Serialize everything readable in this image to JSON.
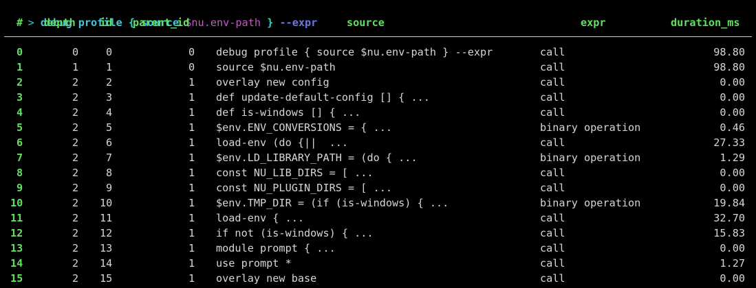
{
  "prompt": {
    "indicator": ">",
    "command": "debug profile",
    "open_brace": "{",
    "inner_command": "source",
    "variable": "$nu.env-path",
    "close_brace": "}",
    "flag": "--expr"
  },
  "table": {
    "columns": [
      "#",
      "depth",
      "id",
      "parent_id",
      "source",
      "expr",
      "duration_ms"
    ],
    "rows": [
      {
        "idx": "0",
        "depth": "0",
        "id": "0",
        "parent_id": "0",
        "source": "debug profile { source $nu.env-path } --expr",
        "expr": "call",
        "duration_ms": "98.80"
      },
      {
        "idx": "1",
        "depth": "1",
        "id": "1",
        "parent_id": "0",
        "source": "source $nu.env-path",
        "expr": "call",
        "duration_ms": "98.80"
      },
      {
        "idx": "2",
        "depth": "2",
        "id": "2",
        "parent_id": "1",
        "source": "overlay new config",
        "expr": "call",
        "duration_ms": "0.00"
      },
      {
        "idx": "3",
        "depth": "2",
        "id": "3",
        "parent_id": "1",
        "source": "def update-default-config [] { ...",
        "expr": "call",
        "duration_ms": "0.00"
      },
      {
        "idx": "4",
        "depth": "2",
        "id": "4",
        "parent_id": "1",
        "source": "def is-windows [] { ...",
        "expr": "call",
        "duration_ms": "0.00"
      },
      {
        "idx": "5",
        "depth": "2",
        "id": "5",
        "parent_id": "1",
        "source": "$env.ENV_CONVERSIONS = { ...",
        "expr": "binary operation",
        "duration_ms": "0.46"
      },
      {
        "idx": "6",
        "depth": "2",
        "id": "6",
        "parent_id": "1",
        "source": "load-env (do {||  ...",
        "expr": "call",
        "duration_ms": "27.33"
      },
      {
        "idx": "7",
        "depth": "2",
        "id": "7",
        "parent_id": "1",
        "source": "$env.LD_LIBRARY_PATH = (do { ...",
        "expr": "binary operation",
        "duration_ms": "1.29"
      },
      {
        "idx": "8",
        "depth": "2",
        "id": "8",
        "parent_id": "1",
        "source": "const NU_LIB_DIRS = [ ...",
        "expr": "call",
        "duration_ms": "0.00"
      },
      {
        "idx": "9",
        "depth": "2",
        "id": "9",
        "parent_id": "1",
        "source": "const NU_PLUGIN_DIRS = [ ...",
        "expr": "call",
        "duration_ms": "0.00"
      },
      {
        "idx": "10",
        "depth": "2",
        "id": "10",
        "parent_id": "1",
        "source": "$env.TMP_DIR = (if (is-windows) { ...",
        "expr": "binary operation",
        "duration_ms": "19.84"
      },
      {
        "idx": "11",
        "depth": "2",
        "id": "11",
        "parent_id": "1",
        "source": "load-env { ...",
        "expr": "call",
        "duration_ms": "32.70"
      },
      {
        "idx": "12",
        "depth": "2",
        "id": "12",
        "parent_id": "1",
        "source": "if not (is-windows) { ...",
        "expr": "call",
        "duration_ms": "15.83"
      },
      {
        "idx": "13",
        "depth": "2",
        "id": "13",
        "parent_id": "1",
        "source": "module prompt { ...",
        "expr": "call",
        "duration_ms": "0.00"
      },
      {
        "idx": "14",
        "depth": "2",
        "id": "14",
        "parent_id": "1",
        "source": "use prompt *",
        "expr": "call",
        "duration_ms": "1.27"
      },
      {
        "idx": "15",
        "depth": "2",
        "id": "15",
        "parent_id": "1",
        "source": "overlay new base",
        "expr": "call",
        "duration_ms": "0.00"
      }
    ]
  },
  "colors": {
    "background": "#000000",
    "header_green": "#5fe05f",
    "prompt_cyan": "#2fd3c8",
    "command_blue": "#43c6e0",
    "variable_magenta": "#c45ac7",
    "flag_indigo": "#6a76e6",
    "text": "#d6d6d6"
  }
}
